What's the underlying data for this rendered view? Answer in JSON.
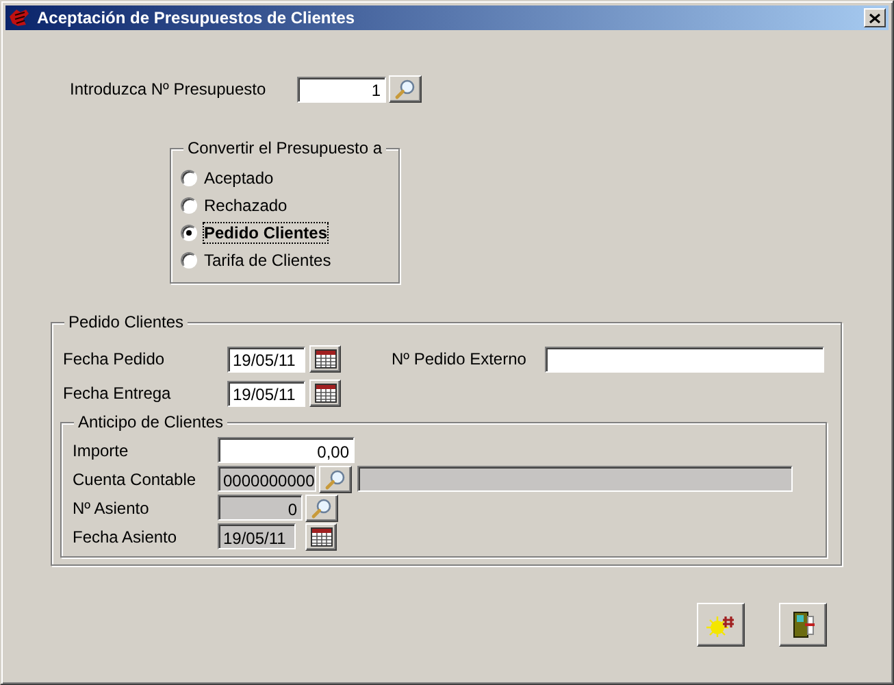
{
  "window": {
    "title": "Aceptación de Presupuestos de Clientes"
  },
  "budget_number": {
    "label": "Introduzca Nº Presupuesto",
    "value": "1"
  },
  "convert_group": {
    "legend": "Convertir el Presupuesto a",
    "options": [
      {
        "label": "Aceptado",
        "selected": false
      },
      {
        "label": "Rechazado",
        "selected": false
      },
      {
        "label": "Pedido Clientes",
        "selected": true
      },
      {
        "label": "Tarifa de Clientes",
        "selected": false
      }
    ]
  },
  "order_group": {
    "legend": "Pedido Clientes",
    "order_date": {
      "label": "Fecha Pedido",
      "value": "19/05/11"
    },
    "delivery_date": {
      "label": "Fecha Entrega",
      "value": "19/05/11"
    },
    "external_order": {
      "label": "Nº Pedido Externo"
    },
    "advance_group": {
      "legend": "Anticipo de Clientes",
      "fields": [
        {
          "kind": "amount",
          "label": "Importe",
          "value": "0,00",
          "disabled": false
        },
        {
          "kind": "account",
          "label": "Cuenta Contable",
          "value": "0000000000",
          "disabled": true
        },
        {
          "kind": "entry",
          "label": "Nº Asiento",
          "value": "0",
          "disabled": true
        },
        {
          "kind": "date",
          "label": "Fecha Asiento",
          "value": "19/05/11",
          "disabled": true
        }
      ]
    }
  }
}
